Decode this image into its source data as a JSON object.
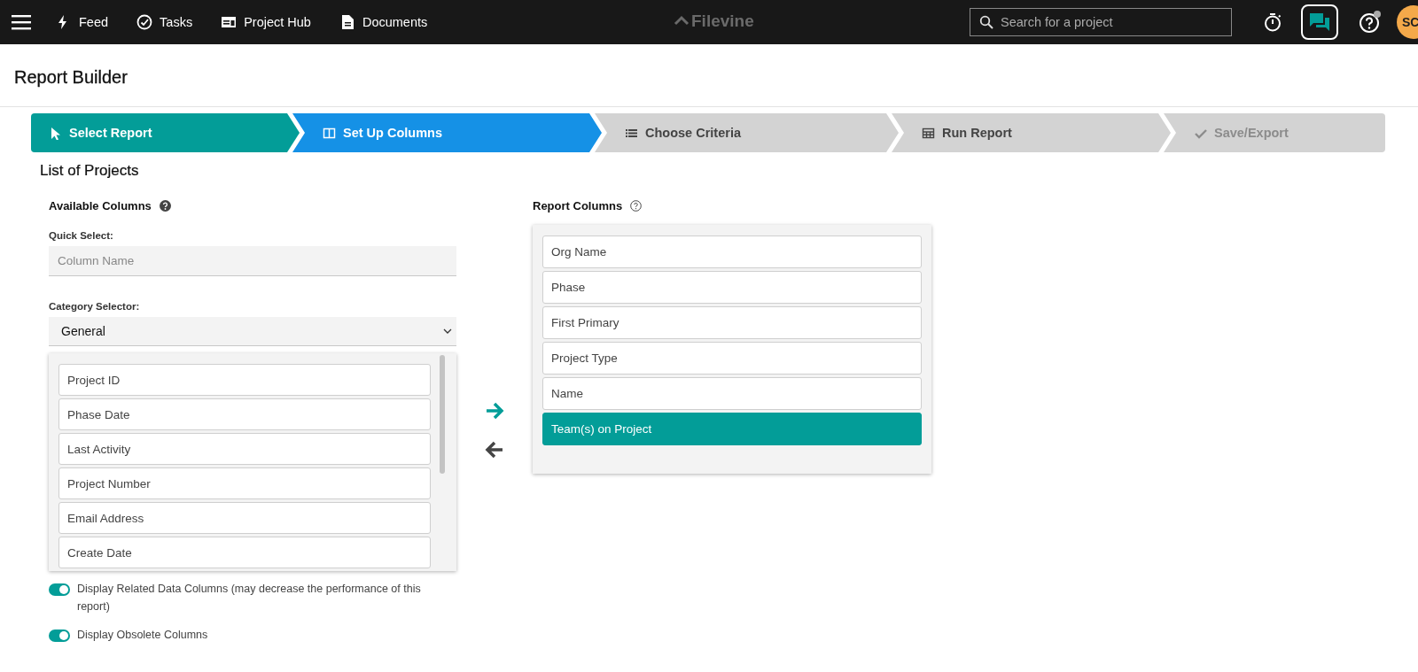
{
  "topbar": {
    "nav": [
      {
        "label": "Feed"
      },
      {
        "label": "Tasks"
      },
      {
        "label": "Project Hub"
      },
      {
        "label": "Documents"
      }
    ],
    "logo": "Filevine",
    "search": {
      "placeholder": "Search for a project"
    },
    "avatar": "SC"
  },
  "page_title": "Report Builder",
  "steps": [
    {
      "label": "Select Report",
      "completed": true,
      "selected": false,
      "disabled": false
    },
    {
      "label": "Set Up Columns",
      "completed": false,
      "selected": true,
      "disabled": false
    },
    {
      "label": "Choose Criteria",
      "completed": false,
      "selected": false,
      "disabled": false
    },
    {
      "label": "Run Report",
      "completed": false,
      "selected": false,
      "disabled": false
    },
    {
      "label": "Save/Export",
      "completed": false,
      "selected": false,
      "disabled": true
    }
  ],
  "section_title": "List of Projects",
  "available": {
    "title": "Available Columns",
    "quick_select_label": "Quick Select:",
    "quick_select_placeholder": "Column Name",
    "category_label": "Category Selector:",
    "category_value": "General",
    "items": [
      {
        "label": "Project ID"
      },
      {
        "label": "Phase Date"
      },
      {
        "label": "Last Activity"
      },
      {
        "label": "Project Number"
      },
      {
        "label": "Email Address"
      },
      {
        "label": "Create Date"
      }
    ]
  },
  "toggles": [
    {
      "label": "Display Related Data Columns (may decrease the performance of this report)",
      "on": true
    },
    {
      "label": "Display Obsolete Columns",
      "on": true
    }
  ],
  "report": {
    "title": "Report Columns",
    "items": [
      {
        "label": "Org Name",
        "selected": false
      },
      {
        "label": "Phase",
        "selected": false
      },
      {
        "label": "First Primary",
        "selected": false
      },
      {
        "label": "Project Type",
        "selected": false
      },
      {
        "label": "Name",
        "selected": false
      },
      {
        "label": "Team(s) on Project",
        "selected": true
      }
    ]
  }
}
